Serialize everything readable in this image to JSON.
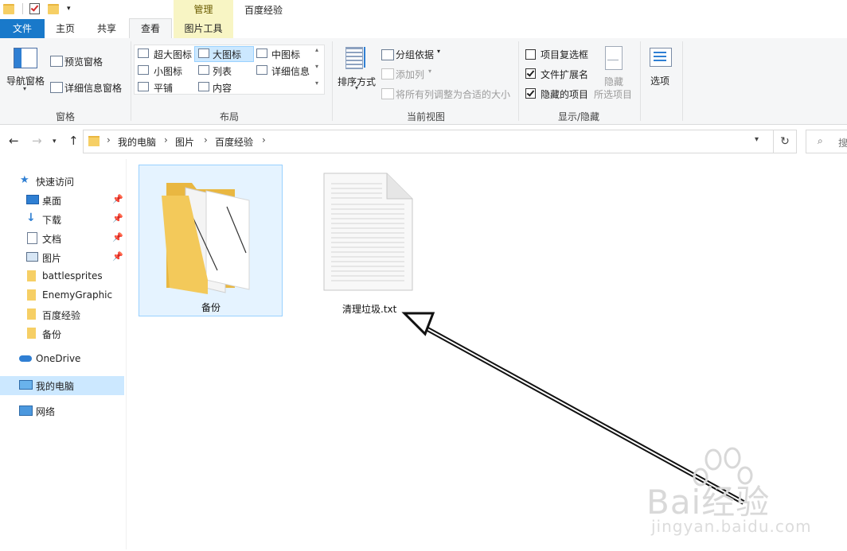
{
  "titlebar": {
    "context_band_label": "管理",
    "window_title": "百度经验"
  },
  "tabs": {
    "file": "文件",
    "home": "主页",
    "share": "共享",
    "view": "查看",
    "picture_tools": "图片工具"
  },
  "ribbon": {
    "pane": {
      "nav_pane": "导航窗格",
      "preview_pane": "预览窗格",
      "details_pane": "详细信息窗格",
      "label": "窗格"
    },
    "layout": {
      "extra_large_icons": "超大图标",
      "large_icons": "大图标",
      "medium_icons": "中图标",
      "small_icons": "小图标",
      "list": "列表",
      "details": "详细信息",
      "tiles": "平铺",
      "content": "内容",
      "label": "布局"
    },
    "current_view": {
      "sort_by": "排序方式",
      "group_by": "分组依据",
      "add_columns": "添加列",
      "size_all_columns": "将所有列调整为合适的大小",
      "label": "当前视图"
    },
    "show_hide": {
      "item_checkboxes": "项目复选框",
      "file_extensions": "文件扩展名",
      "hidden_items": "隐藏的项目",
      "hide_selected": "隐藏",
      "hide_selected_2": "所选项目",
      "label": "显示/隐藏",
      "item_checkboxes_checked": false,
      "file_extensions_checked": true,
      "hidden_items_checked": true
    },
    "options": "选项"
  },
  "address": {
    "crumbs": [
      "我的电脑",
      "图片",
      "百度经验"
    ],
    "search_placeholder": "搜"
  },
  "nav": {
    "quick_access": "快速访问",
    "items": [
      "桌面",
      "下载",
      "文档",
      "图片",
      "battlesprites",
      "EnemyGraphic",
      "百度经验",
      "备份"
    ],
    "onedrive": "OneDrive",
    "this_pc": "我的电脑",
    "network": "网络"
  },
  "content": {
    "folder_name": "备份",
    "file_name": "清理垃圾.txt"
  },
  "watermark": {
    "brand": "Bai经验",
    "url": "jingyan.baidu.com"
  },
  "colors": {
    "file_tab": "#1979ca",
    "context_band": "#f8f5c4",
    "selection": "#cce8ff",
    "folder": "#f6cf65"
  }
}
